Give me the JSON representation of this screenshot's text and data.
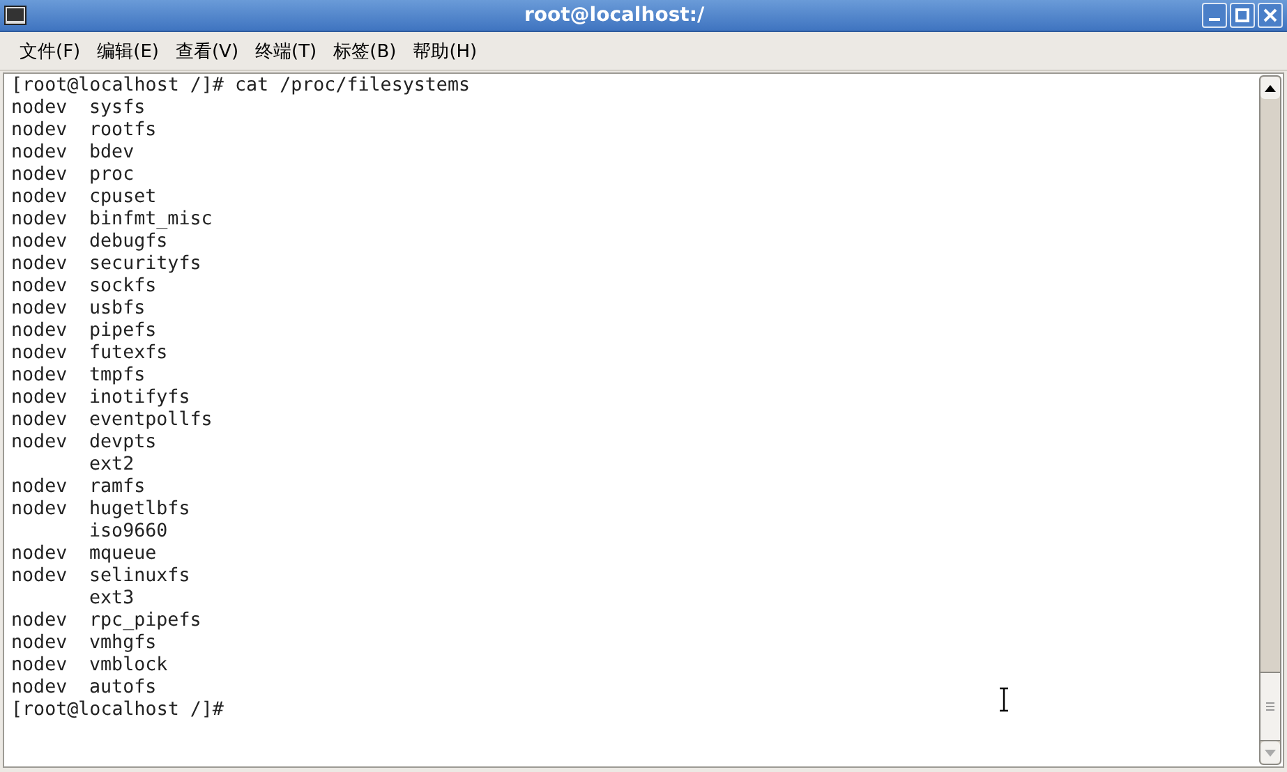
{
  "window": {
    "title": "root@localhost:/"
  },
  "menu": [
    "文件(F)",
    "编辑(E)",
    "查看(V)",
    "终端(T)",
    "标签(B)",
    "帮助(H)"
  ],
  "terminal": {
    "command_line": "[root@localhost /]# cat /proc/filesystems",
    "rows": [
      {
        "flag": "nodev",
        "name": "sysfs"
      },
      {
        "flag": "nodev",
        "name": "rootfs"
      },
      {
        "flag": "nodev",
        "name": "bdev"
      },
      {
        "flag": "nodev",
        "name": "proc"
      },
      {
        "flag": "nodev",
        "name": "cpuset"
      },
      {
        "flag": "nodev",
        "name": "binfmt_misc"
      },
      {
        "flag": "nodev",
        "name": "debugfs"
      },
      {
        "flag": "nodev",
        "name": "securityfs"
      },
      {
        "flag": "nodev",
        "name": "sockfs"
      },
      {
        "flag": "nodev",
        "name": "usbfs"
      },
      {
        "flag": "nodev",
        "name": "pipefs"
      },
      {
        "flag": "nodev",
        "name": "futexfs"
      },
      {
        "flag": "nodev",
        "name": "tmpfs"
      },
      {
        "flag": "nodev",
        "name": "inotifyfs"
      },
      {
        "flag": "nodev",
        "name": "eventpollfs"
      },
      {
        "flag": "nodev",
        "name": "devpts"
      },
      {
        "name": "ext2"
      },
      {
        "flag": "nodev",
        "name": "ramfs"
      },
      {
        "flag": "nodev",
        "name": "hugetlbfs"
      },
      {
        "name": "iso9660"
      },
      {
        "flag": "nodev",
        "name": "mqueue"
      },
      {
        "flag": "nodev",
        "name": "selinuxfs"
      },
      {
        "name": "ext3"
      },
      {
        "flag": "nodev",
        "name": "rpc_pipefs"
      },
      {
        "flag": "nodev",
        "name": "vmhgfs"
      },
      {
        "flag": "nodev",
        "name": "vmblock"
      },
      {
        "flag": "nodev",
        "name": "autofs"
      }
    ],
    "prompt": "[root@localhost /]#"
  }
}
